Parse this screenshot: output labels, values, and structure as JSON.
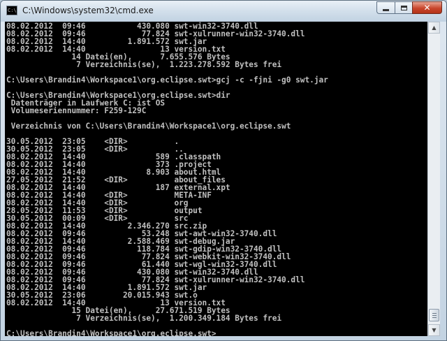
{
  "window": {
    "title": "C:\\Windows\\system32\\cmd.exe",
    "icon_label": "C:\\"
  },
  "scroll": {
    "position_fraction": 0.99
  },
  "console": {
    "lines": [
      "08.02.2012  09:46           430.080 swt-win32-3740.dll",
      "08.02.2012  09:46            77.824 swt-xulrunner-win32-3740.dll",
      "08.02.2012  14:40         1.891.572 swt.jar",
      "08.02.2012  14:40                13 version.txt",
      "              14 Datei(en),      7.655.576 Bytes",
      "               7 Verzeichnis(se),  1.223.278.592 Bytes frei",
      "",
      "C:\\Users\\Brandin4\\Workspace1\\org.eclipse.swt>gcj -c -fjni -g0 swt.jar",
      "",
      "C:\\Users\\Brandin4\\Workspace1\\org.eclipse.swt>dir",
      " Datenträger in Laufwerk C: ist OS",
      " Volumeseriennummer: F259-129C",
      "",
      " Verzeichnis von C:\\Users\\Brandin4\\Workspace1\\org.eclipse.swt",
      "",
      "30.05.2012  23:05    <DIR>          .",
      "30.05.2012  23:05    <DIR>          ..",
      "08.02.2012  14:40               589 .classpath",
      "08.02.2012  14:40               373 .project",
      "08.02.2012  14:40             8.903 about.html",
      "27.05.2012  21:52    <DIR>          about_files",
      "08.02.2012  14:40               187 external.xpt",
      "08.02.2012  14:40    <DIR>          META-INF",
      "08.02.2012  14:40    <DIR>          org",
      "28.05.2012  11:53    <DIR>          output",
      "30.05.2012  00:09    <DIR>          src",
      "08.02.2012  14:40         2.346.270 src.zip",
      "08.02.2012  09:46            53.248 swt-awt-win32-3740.dll",
      "08.02.2012  14:40         2.588.469 swt-debug.jar",
      "08.02.2012  09:46           118.784 swt-gdip-win32-3740.dll",
      "08.02.2012  09:46            77.824 swt-webkit-win32-3740.dll",
      "08.02.2012  09:46            61.440 swt-wgl-win32-3740.dll",
      "08.02.2012  09:46           430.080 swt-win32-3740.dll",
      "08.02.2012  09:46            77.824 swt-xulrunner-win32-3740.dll",
      "08.02.2012  14:40         1.891.572 swt.jar",
      "30.05.2012  23:06        20.015.943 swt.o",
      "08.02.2012  14:40                13 version.txt",
      "              15 Datei(en),     27.671.519 Bytes",
      "               7 Verzeichnis(se),  1.200.349.184 Bytes frei",
      "",
      "C:\\Users\\Brandin4\\Workspace1\\org.eclipse.swt>"
    ]
  }
}
